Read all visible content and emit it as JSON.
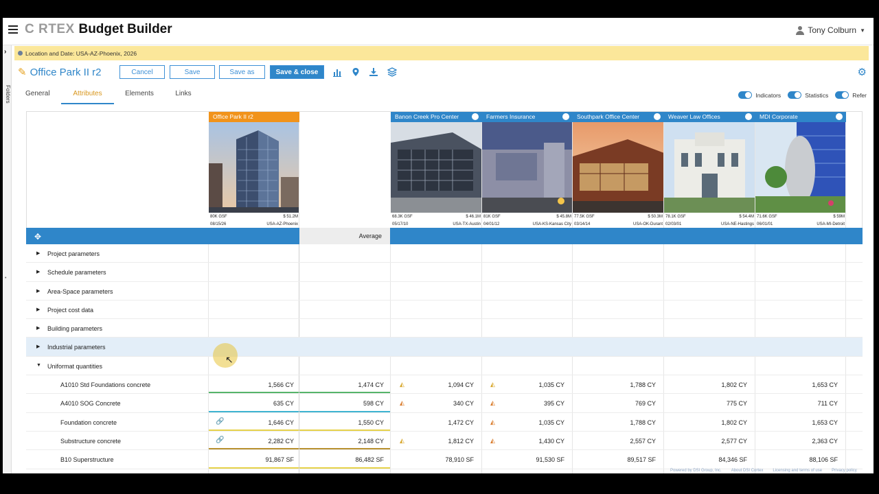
{
  "app": {
    "logo_cortex": "C RTEX",
    "logo_product": "Budget Builder"
  },
  "user": {
    "name": "Tony Colburn"
  },
  "sidebar": {
    "folders_label": "Folders"
  },
  "banner": {
    "text": "Location and Date: USA-AZ-Phoenix, 2026"
  },
  "project": {
    "title": "Office Park II r2"
  },
  "toolbar": {
    "cancel": "Cancel",
    "save": "Save",
    "save_as": "Save as",
    "save_close": "Save & close"
  },
  "tabs": [
    {
      "label": "General"
    },
    {
      "label": "Attributes"
    },
    {
      "label": "Elements"
    },
    {
      "label": "Links"
    }
  ],
  "toggles": [
    {
      "label": "Indicators"
    },
    {
      "label": "Statistics"
    },
    {
      "label": "Refer"
    }
  ],
  "columns": [
    {
      "title": "Office Park II r2",
      "gsf": "80K GSF",
      "cost": "$ 51.2M",
      "date": "08/15/26",
      "loc": "USA-AZ-Phoenix"
    },
    {
      "title": "Banon Creek Pro Center",
      "gsf": "68.3K GSF",
      "cost": "$ 46.1M",
      "date": "05/17/10",
      "loc": "USA-TX-Austin"
    },
    {
      "title": "Farmers Insurance",
      "gsf": "81K GSF",
      "cost": "$ 45.8M",
      "date": "04/01/12",
      "loc": "USA-KS-Kansas City"
    },
    {
      "title": "Southpark Office Center",
      "gsf": "77.5K GSF",
      "cost": "$ 50.3M",
      "date": "03/14/14",
      "loc": "USA-OK-Durant"
    },
    {
      "title": "Weaver Law Offices",
      "gsf": "78.1K GSF",
      "cost": "$ 54.4M",
      "date": "02/03/01",
      "loc": "USA-NE-Hastings"
    },
    {
      "title": "MDI Corporate",
      "gsf": "71.6K GSF",
      "cost": "$ 59M",
      "date": "06/01/01",
      "loc": "USA-MI-Detroit"
    }
  ],
  "average_label": "Average",
  "groups": [
    {
      "label": "Project parameters"
    },
    {
      "label": "Schedule parameters"
    },
    {
      "label": "Area-Space parameters"
    },
    {
      "label": "Project cost data"
    },
    {
      "label": "Building parameters"
    },
    {
      "label": "Industrial parameters"
    },
    {
      "label": "Uniformat quantities"
    }
  ],
  "quantities": [
    {
      "label": "A1010 Std Foundations concrete",
      "cur": "1,566 CY",
      "avg": "1,474 CY",
      "v": [
        "1,094 CY",
        "1,035 CY",
        "1,788 CY",
        "1,802 CY",
        "1,653 CY"
      ]
    },
    {
      "label": "A4010 SOG Concrete",
      "cur": "635 CY",
      "avg": "598 CY",
      "v": [
        "340 CY",
        "395 CY",
        "769 CY",
        "775 CY",
        "711 CY"
      ]
    },
    {
      "label": "Foundation concrete",
      "cur": "1,646 CY",
      "avg": "1,550 CY",
      "v": [
        "1,472 CY",
        "1,035 CY",
        "1,788 CY",
        "1,802 CY",
        "1,653 CY"
      ]
    },
    {
      "label": "Substructure concrete",
      "cur": "2,282 CY",
      "avg": "2,148 CY",
      "v": [
        "1,812 CY",
        "1,430 CY",
        "2,557 CY",
        "2,577 CY",
        "2,363 CY"
      ]
    },
    {
      "label": "B10 Superstructure",
      "cur": "91,867 SF",
      "avg": "86,482 SF",
      "v": [
        "78,910 SF",
        "91,530 SF",
        "89,517 SF",
        "84,346 SF",
        "88,106 SF"
      ]
    }
  ],
  "footer": [
    "Powered by DSI Group, Inc.",
    "About DSI Cortex",
    "Licensing and terms of use",
    "Privacy policy"
  ]
}
